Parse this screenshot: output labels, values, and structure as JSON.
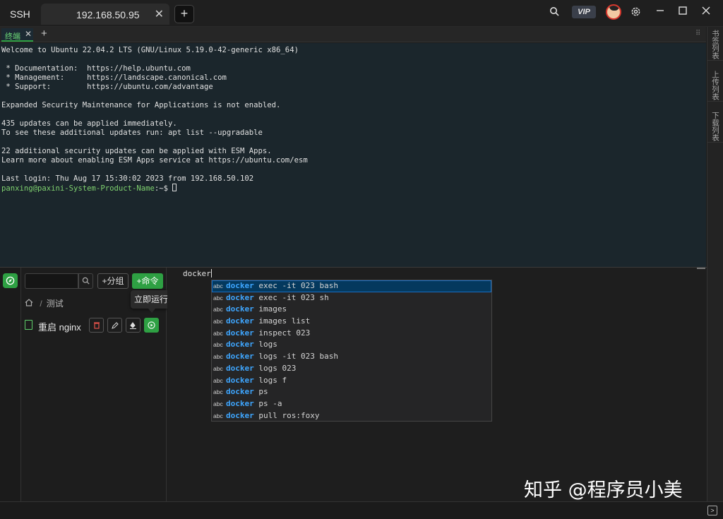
{
  "window": {
    "app_name": "SSH",
    "tab_title": "192.168.50.95",
    "tab_close": "✕",
    "new_tab": "+",
    "vip_label": "VIP",
    "icons": [
      "search-icon",
      "vip-badge",
      "avatar",
      "gear-icon",
      "minimize-icon",
      "maximize-icon",
      "close-icon"
    ]
  },
  "session_tabs": {
    "active_label": "终端",
    "close": "✕",
    "add": "+"
  },
  "terminal": {
    "lines": [
      "Welcome to Ubuntu 22.04.2 LTS (GNU/Linux 5.19.0-42-generic x86_64)",
      "",
      " * Documentation:  https://help.ubuntu.com",
      " * Management:     https://landscape.canonical.com",
      " * Support:        https://ubuntu.com/advantage",
      "",
      "Expanded Security Maintenance for Applications is not enabled.",
      "",
      "435 updates can be applied immediately.",
      "To see these additional updates run: apt list --upgradable",
      "",
      "22 additional security updates can be applied with ESM Apps.",
      "Learn more about enabling ESM Apps service at https://ubuntu.com/esm",
      "",
      "Last login: Thu Aug 17 15:30:02 2023 from 192.168.50.102"
    ],
    "prompt_user": "panxing@paxini-System-Product-Name",
    "prompt_path": ":~$ "
  },
  "right_rail": {
    "items": [
      "书签列表",
      "上传列表",
      "下载列表"
    ]
  },
  "command_panel": {
    "search_placeholder": "",
    "group_button": "+分组",
    "command_button": "+命令",
    "breadcrumb_folder": "测试",
    "breadcrumb_sep": "/",
    "tooltip": "立即运行",
    "items": [
      {
        "name": "重启 nginx"
      }
    ]
  },
  "editor": {
    "text": "docker",
    "suggestions": [
      {
        "match": "docker",
        "rest": " exec -it 023 bash"
      },
      {
        "match": "docker",
        "rest": " exec -it 023 sh"
      },
      {
        "match": "docker",
        "rest": " images"
      },
      {
        "match": "docker",
        "rest": " images list"
      },
      {
        "match": "docker",
        "rest": " inspect 023"
      },
      {
        "match": "docker",
        "rest": " logs"
      },
      {
        "match": "docker",
        "rest": " logs -it 023 bash"
      },
      {
        "match": "docker",
        "rest": " logs 023"
      },
      {
        "match": "docker",
        "rest": " logs f"
      },
      {
        "match": "docker",
        "rest": " ps"
      },
      {
        "match": "docker",
        "rest": " ps -a"
      },
      {
        "match": "docker",
        "rest": " pull ros:foxy"
      }
    ],
    "suggestion_kind": "abc"
  },
  "watermark": "知乎 @程序员小美",
  "colors": {
    "accent_green": "#2ea043",
    "terminal_bg": "#1b262c",
    "match_blue": "#3ea6ff",
    "prompt_green": "#7fd16f"
  }
}
